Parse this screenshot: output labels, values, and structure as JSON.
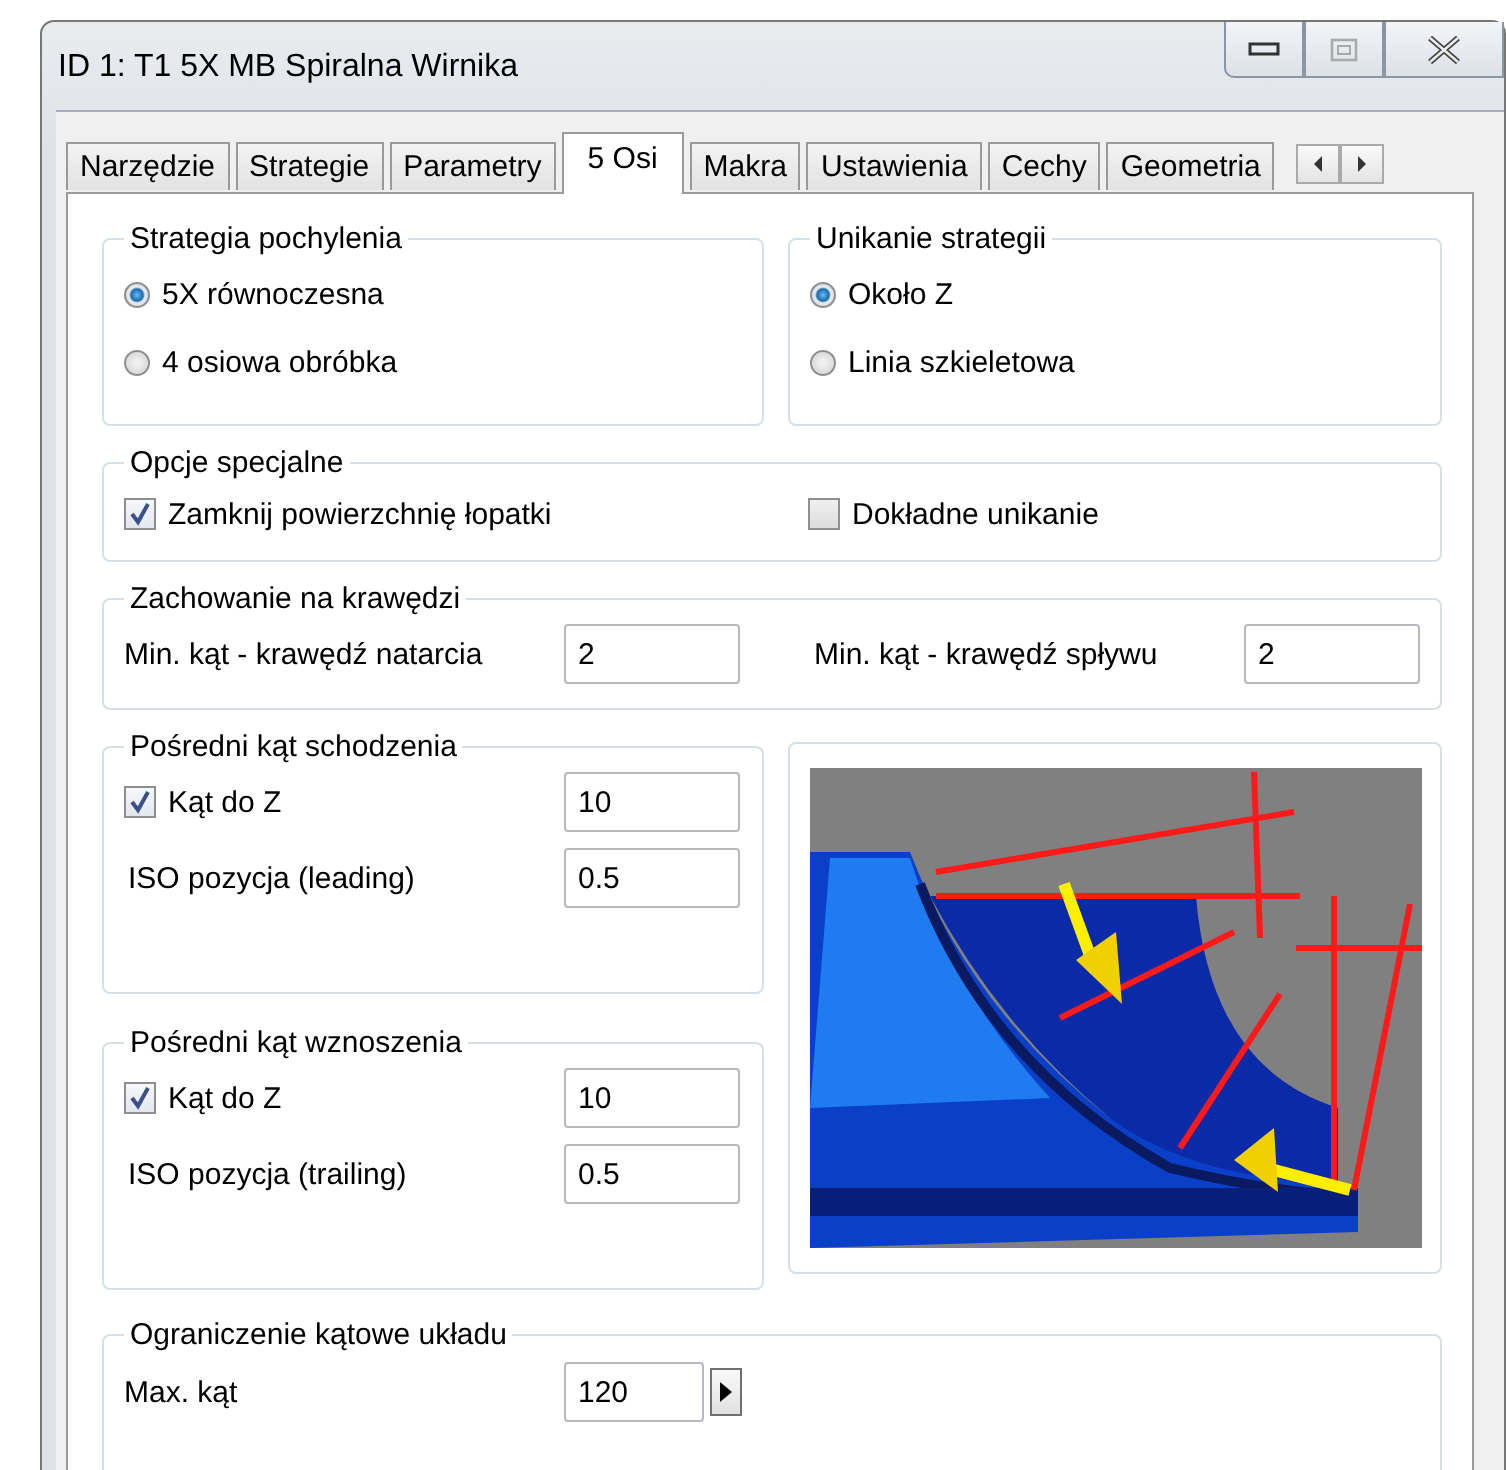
{
  "window": {
    "title": "ID 1: T1 5X MB Spiralna Wirnika"
  },
  "tabs": [
    {
      "label": "Narzędzie",
      "selected": false
    },
    {
      "label": "Strategie",
      "selected": false
    },
    {
      "label": "Parametry",
      "selected": false
    },
    {
      "label": "5 Osi",
      "selected": true
    },
    {
      "label": "Makra",
      "selected": false
    },
    {
      "label": "Ustawienia",
      "selected": false
    },
    {
      "label": "Cechy",
      "selected": false
    },
    {
      "label": "Geometria",
      "selected": false
    }
  ],
  "tilt_strategy": {
    "title": "Strategia pochylenia",
    "options": [
      {
        "label": "5X równoczesna",
        "selected": true
      },
      {
        "label": "4 osiowa obróbka",
        "selected": false
      }
    ]
  },
  "avoidance_strategy": {
    "title": "Unikanie strategii",
    "options": [
      {
        "label": "Około Z",
        "selected": true
      },
      {
        "label": "Linia szkieletowa",
        "selected": false
      }
    ]
  },
  "special_options": {
    "title": "Opcje specjalne",
    "items": [
      {
        "label": "Zamknij powierzchnię łopatki",
        "checked": true
      },
      {
        "label": "Dokładne unikanie",
        "checked": false
      }
    ]
  },
  "edge_behavior": {
    "title": "Zachowanie na krawędzi",
    "fields": [
      {
        "label": "Min. kąt - krawędź natarcia",
        "value": "2"
      },
      {
        "label": "Min. kąt - krawędź spływu",
        "value": "2"
      }
    ]
  },
  "lead_in": {
    "title": "Pośredni kąt schodzenia",
    "angle": {
      "label": "Kąt do Z",
      "checked": true,
      "value": "10"
    },
    "iso": {
      "label": "ISO pozycja (leading)",
      "value": "0.5"
    }
  },
  "lead_out": {
    "title": "Pośredni kąt wznoszenia",
    "angle": {
      "label": "Kąt do Z",
      "checked": true,
      "value": "10"
    },
    "iso": {
      "label": "ISO pozycja (trailing)",
      "value": "0.5"
    }
  },
  "axis_limit": {
    "title": "Ograniczenie kątowe układu",
    "field": {
      "label": "Max. kąt",
      "value": "120"
    }
  }
}
